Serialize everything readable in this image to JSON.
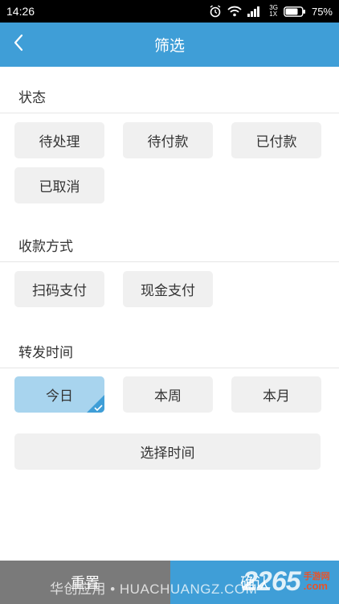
{
  "status_bar": {
    "time": "14:26",
    "network_type": "3G",
    "sim_label": "1X",
    "battery": "75%",
    "battery_level": 75
  },
  "header": {
    "title": "筛选",
    "back_icon": "chevron-left-icon"
  },
  "sections": {
    "status": {
      "title": "状态",
      "options": [
        "待处理",
        "待付款",
        "已付款",
        "已取消"
      ]
    },
    "payment": {
      "title": "收款方式",
      "options": [
        "扫码支付",
        "现金支付"
      ]
    },
    "forward_time": {
      "title": "转发时间",
      "options": [
        "今日",
        "本周",
        "本月"
      ],
      "selected": "今日",
      "custom_label": "选择时间"
    }
  },
  "footer": {
    "reset_label": "重置",
    "confirm_label": "确认"
  },
  "watermark": {
    "text": "华创应用 • HUACHUANGZ.COM",
    "logo_number": "2265",
    "logo_cn": "手游网",
    "logo_com": ".com"
  },
  "colors": {
    "accent": "#3f9ed7",
    "selected_chip": "#a8d4ee",
    "chip": "#f0f0f0",
    "reset": "#7a7a7a"
  }
}
